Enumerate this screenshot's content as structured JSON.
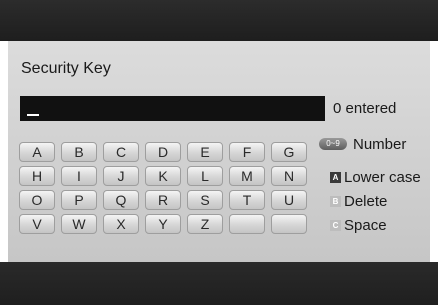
{
  "title": "Security Key",
  "input": {
    "value": "",
    "entered_count": "0 entered"
  },
  "keyboard": {
    "rows": [
      [
        "A",
        "B",
        "C",
        "D",
        "E",
        "F",
        "G"
      ],
      [
        "H",
        "I",
        "J",
        "K",
        "L",
        "M",
        "N"
      ],
      [
        "O",
        "P",
        "Q",
        "R",
        "S",
        "T",
        "U"
      ],
      [
        "V",
        "W",
        "X",
        "Y",
        "Z",
        "",
        ""
      ]
    ]
  },
  "legend": {
    "number": {
      "badge": "0~9",
      "label": "Number"
    },
    "lower_case": {
      "key": "A",
      "label": "Lower case",
      "color": "#3a3a3a"
    },
    "delete": {
      "key": "B",
      "label": "Delete",
      "color": "#bdbdbd"
    },
    "space": {
      "key": "C",
      "label": "Space",
      "color": "#bdbdbd"
    }
  }
}
